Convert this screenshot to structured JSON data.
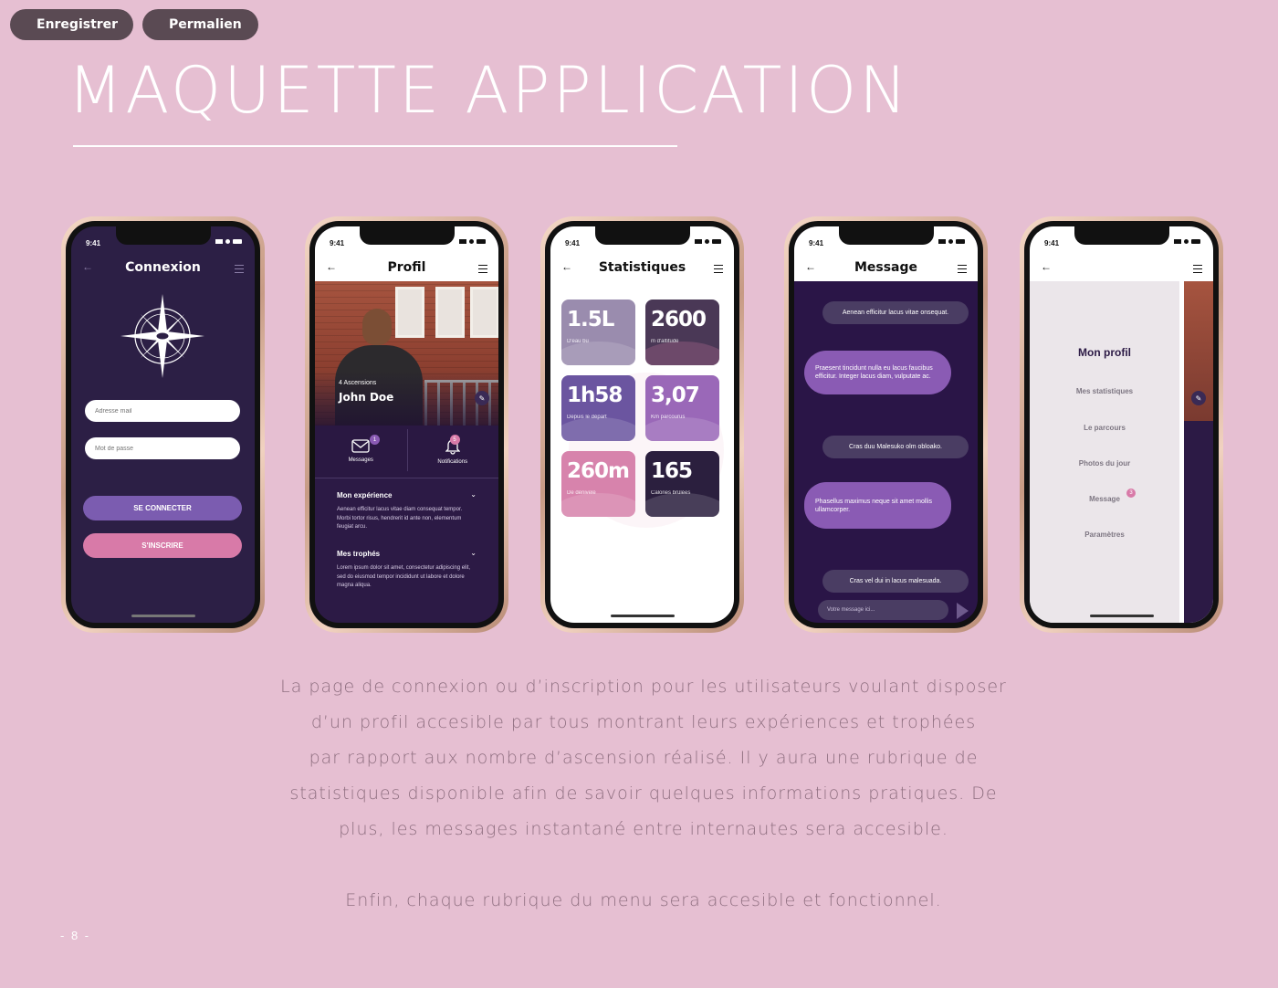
{
  "toolbar": {
    "save_label": "Enregistrer",
    "permalink_label": "Permalien"
  },
  "page": {
    "title": "MAQUETTE APPLICATION",
    "description_lines": [
      "La page de connexion ou d’inscription pour les utilisateurs voulant disposer",
      "d’un profil accesible par tous montrant leurs expériences et trophées",
      "par rapport aux nombre d’ascension réalisé. Il y aura une rubrique de",
      "statistiques disponible afin de savoir quelques informations pratiques. De",
      "plus, les messages instantané entre internautes sera accesible."
    ],
    "closing": "Enfin, chaque rubrique du menu sera accesible et fonctionnel.",
    "page_number": "- 8 -"
  },
  "colors": {
    "background": "#e6bfd2",
    "dark_purple": "#2b1f45",
    "accent_purple": "#7b5cb0",
    "accent_pink": "#d87aa8"
  },
  "phones": {
    "status_time": "9:41",
    "login": {
      "title": "Connexion",
      "email_placeholder": "Adresse mail",
      "password_placeholder": "Mot de passe",
      "connect_button": "SE CONNECTER",
      "register_button": "S'INSCRIRE"
    },
    "profile": {
      "title": "Profil",
      "ascensions": "4 Ascensions",
      "name": "John Doe",
      "messages_label": "Messages",
      "messages_badge": "1",
      "notifications_label": "Notifications",
      "notifications_badge": "5",
      "experience_title": "Mon expérience",
      "experience_text": "Aenean efficitur lacus vitae diam consequat tempor. Morbi tortor risus, hendrerit id ante non, elementum feugiat arcu.",
      "trophies_title": "Mes trophés",
      "trophies_text": "Lorem ipsum dolor sit amet, consectetur adipiscing elit, sed do eiusmod tempor incididunt ut labore et dolore magna aliqua."
    },
    "stats": {
      "title": "Statistiques",
      "tiles": [
        {
          "value": "1.5L",
          "label": "D'eau bu"
        },
        {
          "value": "2600",
          "label": "m d'altitude"
        },
        {
          "value": "1h58",
          "label": "Depuis le départ"
        },
        {
          "value": "3,07",
          "label": "Km parcourus"
        },
        {
          "value": "260m",
          "label": "De dénivelé"
        },
        {
          "value": "165",
          "label": "Calories brûlées"
        }
      ]
    },
    "messages": {
      "title": "Message",
      "items": [
        "Aenean efficitur lacus vitae onsequat.",
        "Praesent tincidunt nulla eu lacus faucibus efficitur. Integer lacus diam, vulputate ac.",
        "Cras duu Malesuko olm obloako.",
        "Phasellus maximus neque sit amet mollis ullamcorper.",
        "Cras vel dui in lacus malesuada."
      ],
      "input_placeholder": "Votre message ici..."
    },
    "menu": {
      "title": "Mon profil",
      "items": [
        "Mes statistiques",
        "Le parcours",
        "Photos du jour",
        "Message",
        "Paramètres"
      ],
      "message_badge": "3"
    }
  }
}
